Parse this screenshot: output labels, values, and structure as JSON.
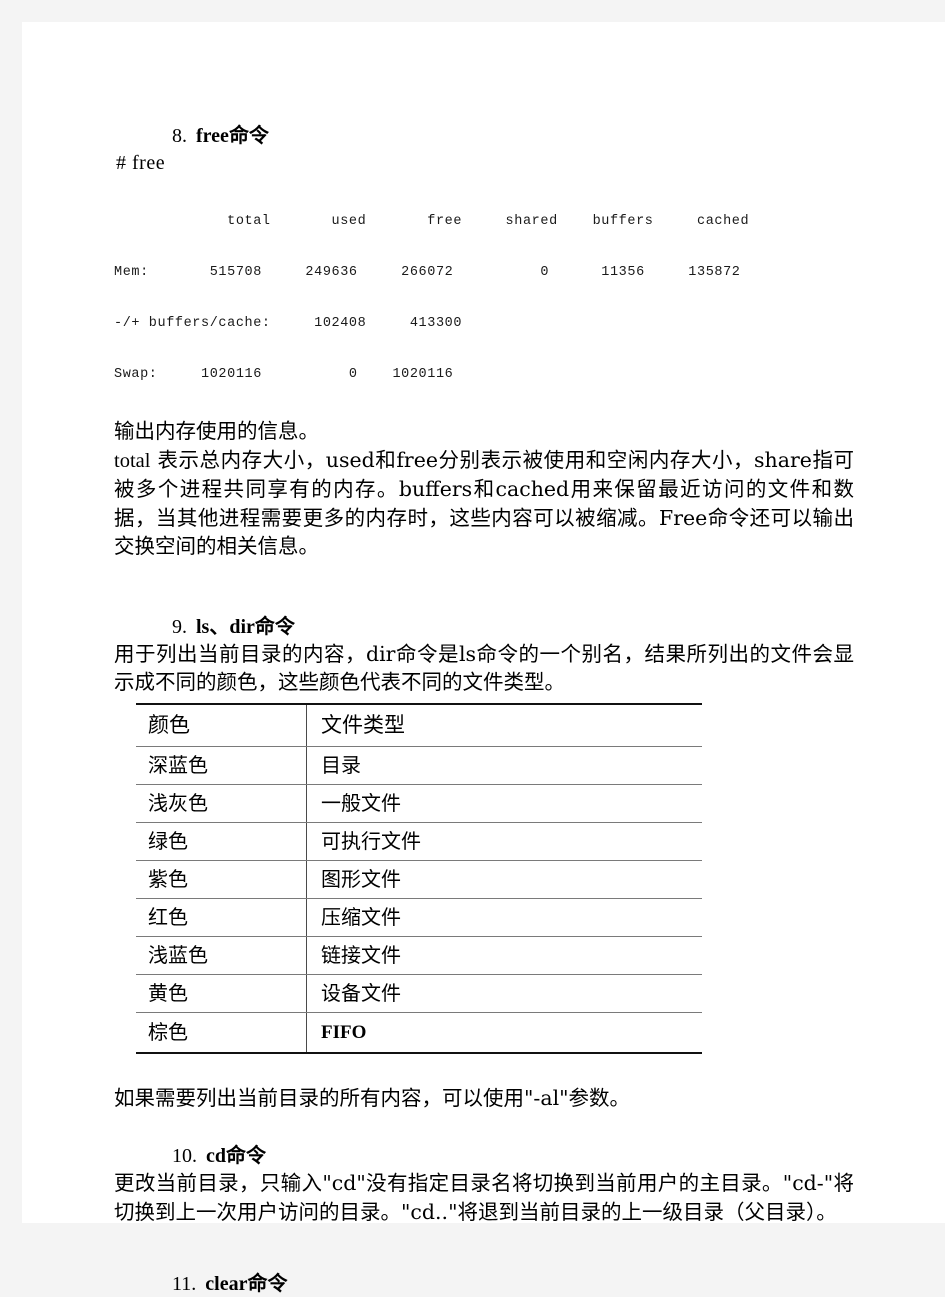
{
  "document": {
    "sections": [
      {
        "number": "8.",
        "title_latin": "free",
        "title_cn": "命令"
      },
      {
        "number": "9.",
        "title_latin": "ls、dir",
        "title_cn": "命令"
      },
      {
        "number": "10.",
        "title_latin": "cd",
        "title_cn": "命令"
      },
      {
        "number": "11.",
        "title_latin": "clear",
        "title_cn": "命令"
      }
    ],
    "free_section": {
      "prompt": "#  free",
      "terminal": {
        "header": "             total       used       free     shared    buffers     cached",
        "row_mem": "Mem:       515708     249636     266072          0      11356     135872",
        "row_buffers": "-/+ buffers/cache:     102408     413300",
        "row_swap": "Swap:     1020116          0    1020116"
      },
      "desc_line1": "输出内存使用的信息。",
      "desc_body_prefix": "total",
      "desc_body": "        表示总内存大小，used和free分别表示被使用和空闲内存大小，share指可被多个进程共同享有的内存。buffers和cached用来保留最近访问的文件和数据，当其他进程需要更多的内存时，这些内容可以被缩减。Free命令还可以输出交换空间的相关信息。"
    },
    "ls_section": {
      "description": "用于列出当前目录的内容，dir命令是ls命令的一个别名，结果所列出的文件会显示成不同的颜色，这些颜色代表不同的文件类型。",
      "table": {
        "headers": [
          "颜色",
          "文件类型"
        ],
        "rows": [
          [
            "深蓝色",
            "目录"
          ],
          [
            "浅灰色",
            "一般文件"
          ],
          [
            "绿色",
            "可执行文件"
          ],
          [
            "紫色",
            "图形文件"
          ],
          [
            "红色",
            "压缩文件"
          ],
          [
            "浅蓝色",
            "链接文件"
          ],
          [
            "黄色",
            "设备文件"
          ],
          [
            "棕色",
            "FIFO"
          ]
        ]
      },
      "footer_note": "如果需要列出当前目录的所有内容，可以使用\"-al\"参数。"
    },
    "cd_section": {
      "description": "更改当前目录，只输入\"cd\"没有指定目录名将切换到当前用户的主目录。\"cd-\"将切换到上一次用户访问的目录。\"cd..\"将退到当前目录的上一级目录（父目录）。"
    }
  }
}
